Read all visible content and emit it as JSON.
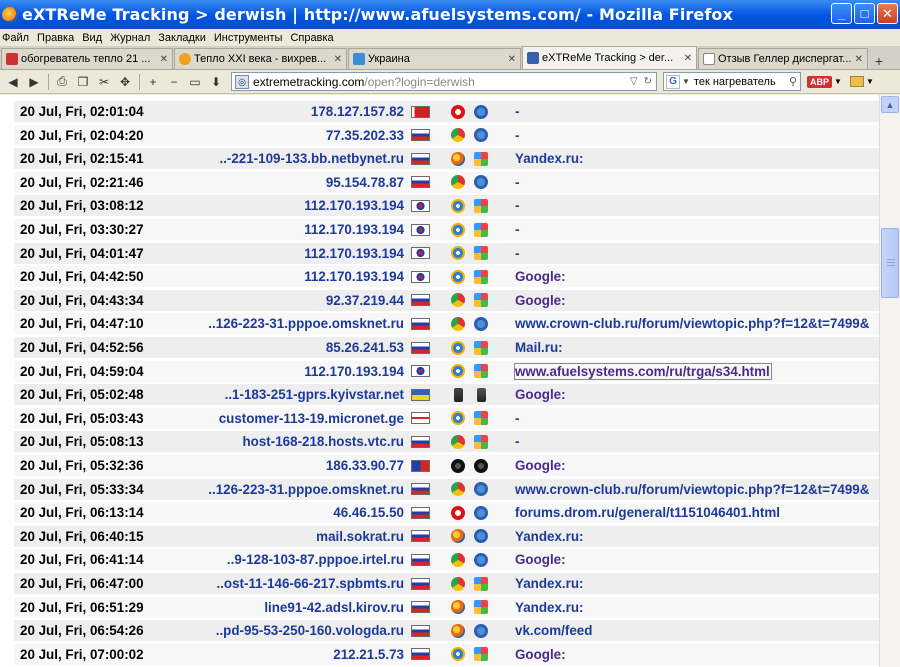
{
  "window": {
    "title": "eXTReMe Tracking > derwish | http://www.afuelsystems.com/ - Mozilla Firefox",
    "minimize": "_",
    "maximize": "□",
    "close": "✕"
  },
  "menu": [
    "Файл",
    "Правка",
    "Вид",
    "Журнал",
    "Закладки",
    "Инструменты",
    "Справка"
  ],
  "tabs": [
    {
      "label": "обогреватель тепло 21 ...",
      "icon_color": "#cc3333",
      "active": false
    },
    {
      "label": "Тепло XXI века - вихрев...",
      "icon_color": "#f0a020",
      "active": false
    },
    {
      "label": "Украина",
      "icon_color": "#3a8fd8",
      "active": false
    },
    {
      "label": "eXTReMe Tracking > der...",
      "icon_color": "#3a5fb0",
      "active": true
    },
    {
      "label": "Отзыв Геллер диспергат...",
      "icon_color": "#ffffff",
      "active": false
    }
  ],
  "nav": {
    "url_host": "extremetracking.com",
    "url_path": "/open?login=derwish",
    "search_value": "тек нагреватель",
    "addon_label": "ABP"
  },
  "rows": [
    {
      "date": "20 Jul, Fri, 02:01:04",
      "host": "178.127.157.82",
      "flag": "by",
      "browser": "opera",
      "os": "win7",
      "ref": "-"
    },
    {
      "date": "20 Jul, Fri, 02:04:20",
      "host": "77.35.202.33",
      "flag": "ru",
      "browser": "chrome",
      "os": "win7",
      "ref": "-"
    },
    {
      "date": "20 Jul, Fri, 02:15:41",
      "host": "..-221-109-133.bb.netbynet.ru",
      "flag": "ru",
      "browser": "firefox",
      "os": "winxp",
      "ref": "Yandex.ru:"
    },
    {
      "date": "20 Jul, Fri, 02:21:46",
      "host": "95.154.78.87",
      "flag": "ru",
      "browser": "chrome",
      "os": "win7",
      "ref": "-"
    },
    {
      "date": "20 Jul, Fri, 03:08:12",
      "host": "112.170.193.194",
      "flag": "kr",
      "browser": "ie",
      "os": "winxp",
      "ref": "-"
    },
    {
      "date": "20 Jul, Fri, 03:30:27",
      "host": "112.170.193.194",
      "flag": "kr",
      "browser": "ie",
      "os": "winxp",
      "ref": "-"
    },
    {
      "date": "20 Jul, Fri, 04:01:47",
      "host": "112.170.193.194",
      "flag": "kr",
      "browser": "ie",
      "os": "winxp",
      "ref": "-"
    },
    {
      "date": "20 Jul, Fri, 04:42:50",
      "host": "112.170.193.194",
      "flag": "kr",
      "browser": "ie",
      "os": "winxp",
      "ref": "Google:",
      "ref_style": "g"
    },
    {
      "date": "20 Jul, Fri, 04:43:34",
      "host": "92.37.219.44",
      "flag": "ru",
      "browser": "chrome",
      "os": "winxp",
      "ref": "Google:",
      "ref_style": "g"
    },
    {
      "date": "20 Jul, Fri, 04:47:10",
      "host": "..126-223-31.pppoe.omsknet.ru",
      "flag": "ru",
      "browser": "chrome",
      "os": "win7",
      "ref": "www.crown-club.ru/forum/viewtopic.php?f=12&t=7499&"
    },
    {
      "date": "20 Jul, Fri, 04:52:56",
      "host": "85.26.241.53",
      "flag": "ru",
      "browser": "ie",
      "os": "winxp",
      "ref": "Mail.ru:"
    },
    {
      "date": "20 Jul, Fri, 04:59:04",
      "host": "112.170.193.194",
      "flag": "kr",
      "browser": "ie",
      "os": "winxp",
      "ref": "www.afuelsystems.com/ru/trga/s34.html",
      "ref_style": "sel"
    },
    {
      "date": "20 Jul, Fri, 05:02:48",
      "host": "..1-183-251-gprs.kyivstar.net",
      "flag": "ua",
      "browser": "mobile",
      "os": "mobile",
      "ref": "Google:",
      "ref_style": "g"
    },
    {
      "date": "20 Jul, Fri, 05:03:43",
      "host": "customer-113-19.micronet.ge",
      "flag": "ge",
      "browser": "ie",
      "os": "winxp",
      "ref": "-"
    },
    {
      "date": "20 Jul, Fri, 05:08:13",
      "host": "host-168-218.hosts.vtc.ru",
      "flag": "ru",
      "browser": "chrome",
      "os": "winxp",
      "ref": "-"
    },
    {
      "date": "20 Jul, Fri, 05:32:36",
      "host": "186.33.90.77",
      "flag": "do",
      "browser": "bb",
      "os": "bb",
      "ref": "Google:",
      "ref_style": "g"
    },
    {
      "date": "20 Jul, Fri, 05:33:34",
      "host": "..126-223-31.pppoe.omsknet.ru",
      "flag": "ru",
      "browser": "chrome",
      "os": "win7",
      "ref": "www.crown-club.ru/forum/viewtopic.php?f=12&t=7499&"
    },
    {
      "date": "20 Jul, Fri, 06:13:14",
      "host": "46.46.15.50",
      "flag": "ru",
      "browser": "opera",
      "os": "win7",
      "ref": "forums.drom.ru/general/t1151046401.html"
    },
    {
      "date": "20 Jul, Fri, 06:40:15",
      "host": "mail.sokrat.ru",
      "flag": "ru",
      "browser": "firefox",
      "os": "win7",
      "ref": "Yandex.ru:"
    },
    {
      "date": "20 Jul, Fri, 06:41:14",
      "host": "..9-128-103-87.pppoe.irtel.ru",
      "flag": "ru",
      "browser": "chrome",
      "os": "win7",
      "ref": "Google:",
      "ref_style": "g"
    },
    {
      "date": "20 Jul, Fri, 06:47:00",
      "host": "..ost-11-146-66-217.spbmts.ru",
      "flag": "ru",
      "browser": "chrome",
      "os": "winxp",
      "ref": "Yandex.ru:"
    },
    {
      "date": "20 Jul, Fri, 06:51:29",
      "host": "line91-42.adsl.kirov.ru",
      "flag": "ru",
      "browser": "firefox",
      "os": "winxp",
      "ref": "Yandex.ru:"
    },
    {
      "date": "20 Jul, Fri, 06:54:26",
      "host": "..pd-95-53-250-160.vologda.ru",
      "flag": "ru",
      "browser": "firefox",
      "os": "win7",
      "ref": "vk.com/feed"
    },
    {
      "date": "20 Jul, Fri, 07:00:02",
      "host": "212.21.5.73",
      "flag": "ru",
      "browser": "ie",
      "os": "winxp",
      "ref": "Google:",
      "ref_style": "g"
    }
  ],
  "colors": {
    "link": "#1d3a9a",
    "visited": "#4b2a8a",
    "row_even": "#eeeeee",
    "row_odd": "#f7f7f7"
  }
}
